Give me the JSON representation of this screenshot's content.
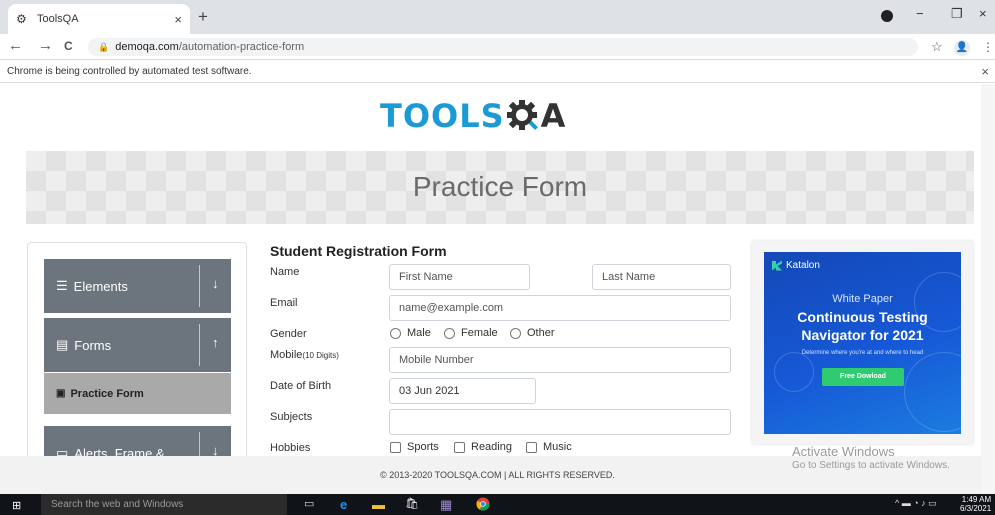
{
  "browser": {
    "tab_title": "ToolsQA",
    "tab_close": "×",
    "new_tab": "+",
    "url_host": "demoqa.com",
    "url_path": "/automation-practice-form",
    "infobar_text": "Chrome is being controlled by automated test software.",
    "infobar_close": "×",
    "back": "←",
    "forward": "→",
    "reload": "C",
    "lock": "🔒",
    "star": "☆",
    "account": "👤",
    "menu": "⋮",
    "window_minimize": "−",
    "window_restore": "❐",
    "window_close": "×"
  },
  "site": {
    "logo_part1": "TOOLS",
    "logo_part2": "A",
    "page_title": "Practice Form",
    "footer": "© 2013-2020 TOOLSQA.COM | ALL RIGHTS RESERVED."
  },
  "sidebar": {
    "groups": [
      {
        "label": "Elements",
        "icon": "hamburger-icon",
        "arrow": "↓"
      },
      {
        "label": "Forms",
        "icon": "form-icon",
        "arrow": "↑"
      },
      {
        "label": "Alerts, Frame &",
        "icon": "window-icon",
        "arrow": "↓"
      }
    ],
    "active_item": "Practice Form"
  },
  "form": {
    "title": "Student Registration Form",
    "name_label": "Name",
    "first_name_placeholder": "First Name",
    "last_name_placeholder": "Last Name",
    "email_label": "Email",
    "email_placeholder": "name@example.com",
    "gender_label": "Gender",
    "gender_options": [
      "Male",
      "Female",
      "Other"
    ],
    "mobile_label": "Mobile",
    "mobile_hint": "(10 Digits)",
    "mobile_placeholder": "Mobile Number",
    "dob_label": "Date of Birth",
    "dob_value": "03 Jun 2021",
    "subjects_label": "Subjects",
    "hobbies_label": "Hobbies",
    "hobbies_options": [
      "Sports",
      "Reading",
      "Music"
    ]
  },
  "ad": {
    "brand": "Katalon",
    "kicker": "White Paper",
    "headline_1": "Continuous Testing",
    "headline_2": "Navigator for 2021",
    "subline": "Determine where you're at and where to head",
    "cta": "Free Dowload"
  },
  "windows": {
    "activate_title": "Activate Windows",
    "activate_sub": "Go to Settings to activate Windows.",
    "search_placeholder": "Search the web and Windows",
    "time": "1:49 AM",
    "date": "6/3/2021"
  },
  "colors": {
    "accent": "#1c9ad6",
    "sidebar_group": "#6c757d",
    "sidebar_active": "#aaa9a9",
    "ad_blue": "#1658d6",
    "ad_cta": "#2ecb70"
  }
}
